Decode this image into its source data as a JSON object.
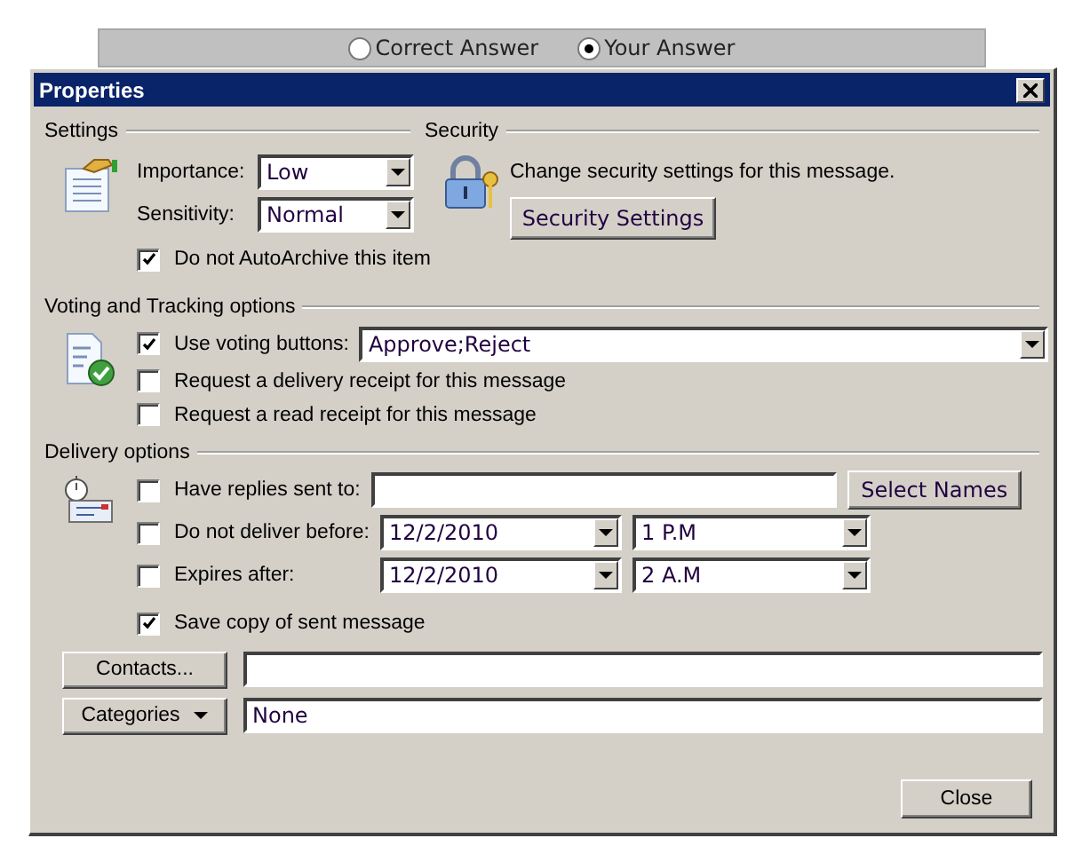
{
  "answer_toggle": [
    {
      "label": "Correct Answer",
      "selected": false
    },
    {
      "label": "Your Answer",
      "selected": true
    }
  ],
  "window": {
    "title": "Properties"
  },
  "settings": {
    "heading": "Settings",
    "fields": [
      {
        "label": "Importance:",
        "value": "Low"
      },
      {
        "label": "Sensitivity:",
        "value": "Normal"
      }
    ],
    "archive": {
      "label": "Do not AutoArchive this item",
      "checked": true
    }
  },
  "security": {
    "heading": "Security",
    "text": "Change security settings for this message.",
    "button": "Security Settings"
  },
  "voting": {
    "heading": "Voting and Tracking options",
    "use_voting": {
      "label": "Use voting buttons:",
      "checked": true,
      "value": "Approve;Reject"
    },
    "receipts": [
      {
        "label": "Request a delivery receipt for this message",
        "checked": false
      },
      {
        "label": "Request a read receipt for this message",
        "checked": false
      }
    ]
  },
  "delivery": {
    "heading": "Delivery options",
    "replies": {
      "label": "Have replies sent to:",
      "checked": false,
      "button": "Select Names"
    },
    "schedule": [
      {
        "label": "Do not deliver before:",
        "checked": false,
        "date": "12/2/2010",
        "time": "1 P.M"
      },
      {
        "label": "Expires after:",
        "checked": false,
        "date": "12/2/2010",
        "time": "2 A.M"
      }
    ],
    "save_copy": {
      "label": "Save copy of sent message",
      "checked": true
    }
  },
  "contacts": {
    "button": "Contacts..."
  },
  "categories": {
    "button": "Categories",
    "value": "None"
  },
  "close_button": "Close"
}
